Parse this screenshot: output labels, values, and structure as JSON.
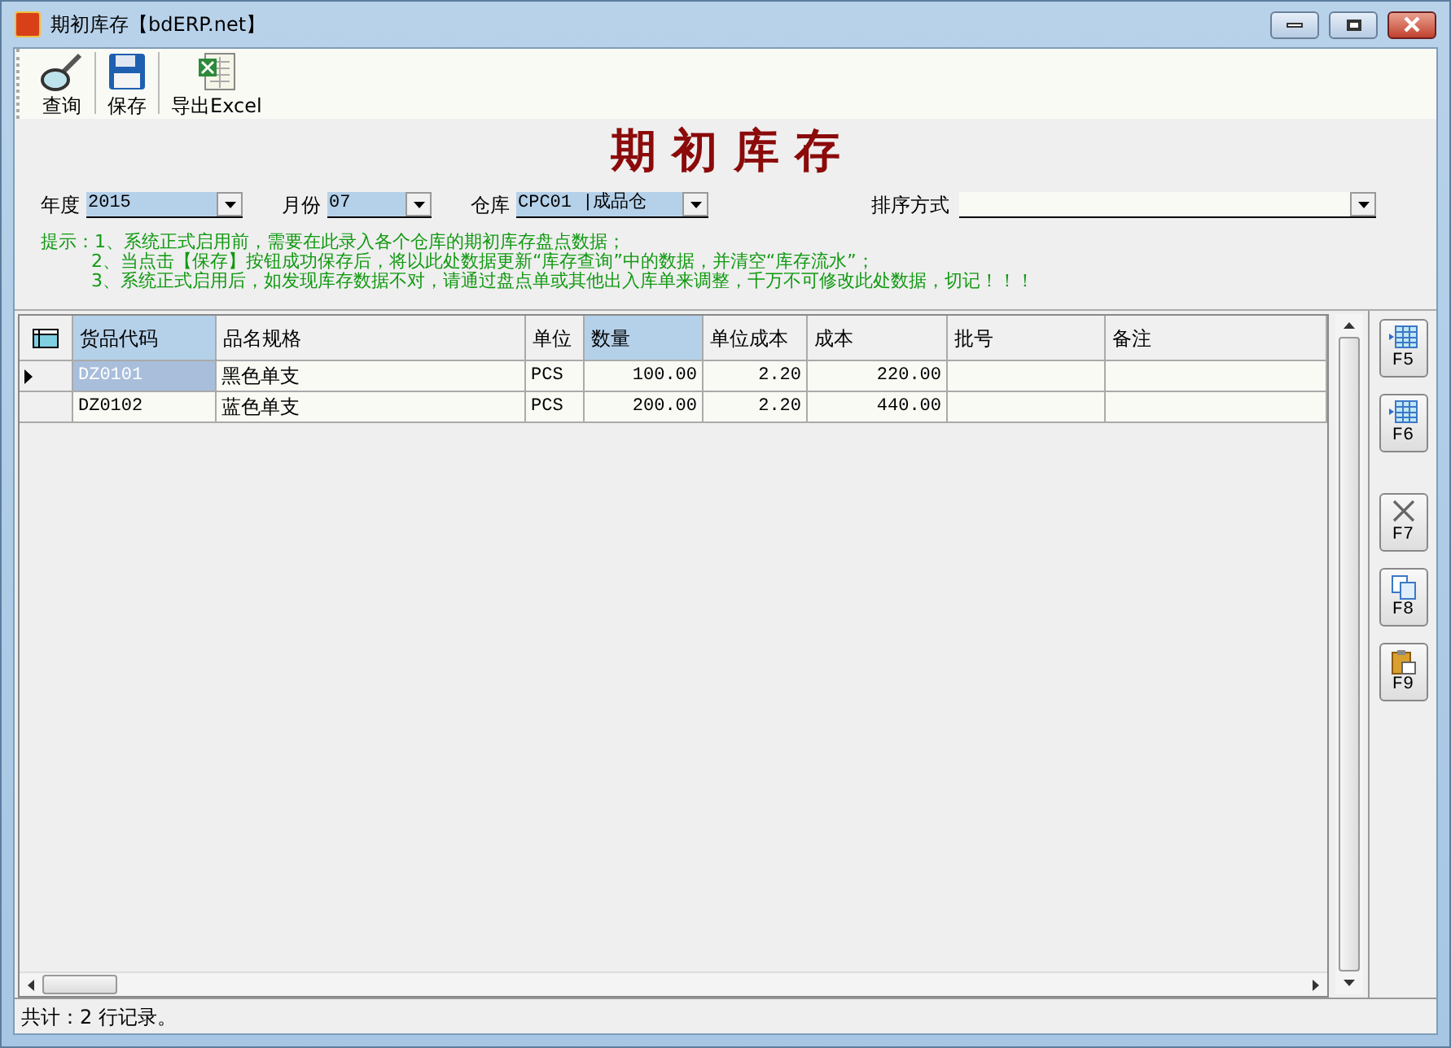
{
  "window": {
    "title": "期初库存【bdERP.net】"
  },
  "toolbar": [
    {
      "kind": "search",
      "label": "查询"
    },
    {
      "kind": "save",
      "label": "保存"
    },
    {
      "kind": "excel",
      "label": "导出Excel"
    }
  ],
  "heading": "期 初 库 存",
  "filters": [
    {
      "label": "年度",
      "value": "2015"
    },
    {
      "label": "月份",
      "value": "07"
    },
    {
      "label": "仓库",
      "value": "CPC01 |成品仓"
    }
  ],
  "sort": {
    "label": "排序方式"
  },
  "hints": [
    "提示：1、系统正式启用前，需要在此录入各个仓库的期初库存盘点数据；",
    "2、当点击【保存】按钮成功保存后，将以此处数据更新“库存查询”中的数据，并清空“库存流水”；",
    "3、系统正式启用后，如发现库存数据不对，请通过盘点单或其他出入库单来调整，千万不可修改此处数据，切记！！！"
  ],
  "table": {
    "columns": [
      {
        "label": "货品代码",
        "highlighted": true
      },
      {
        "label": "品名规格",
        "highlighted": false
      },
      {
        "label": "单位",
        "highlighted": false
      },
      {
        "label": "数量",
        "highlighted": true
      },
      {
        "label": "单位成本",
        "highlighted": false
      },
      {
        "label": "成本",
        "highlighted": false
      },
      {
        "label": "批号",
        "highlighted": false
      },
      {
        "label": "备注",
        "highlighted": false
      }
    ],
    "rows": [
      {
        "selected": true,
        "cells": [
          "DZ0101",
          "黑色单支",
          "PCS",
          "100.00",
          "2.20",
          "220.00"
        ]
      },
      {
        "selected": false,
        "cells": [
          "DZ0102",
          "蓝色单支",
          "PCS",
          "200.00",
          "2.20",
          "440.00"
        ]
      }
    ]
  },
  "side_buttons": [
    {
      "kind": "add",
      "label": "F5"
    },
    {
      "kind": "insert",
      "label": "F6"
    },
    {
      "kind": "delete",
      "label": "F7"
    },
    {
      "kind": "copy",
      "label": "F8"
    },
    {
      "kind": "paste",
      "label": "F9"
    }
  ],
  "status_bar": "共计：2 行记录。"
}
